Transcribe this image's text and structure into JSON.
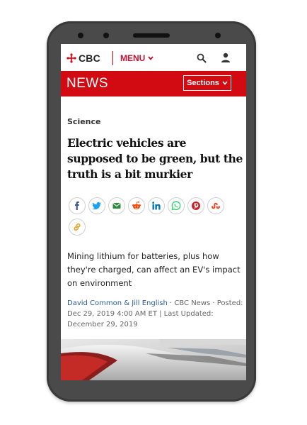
{
  "header": {
    "logo_text": "CBC",
    "menu_label": "MENU",
    "menu_chevron": "⌄"
  },
  "newsbar": {
    "title": "NEWS",
    "sections_label": "Sections",
    "sections_chevron": "⌄"
  },
  "article": {
    "category": "Science",
    "headline": "Electric vehicles are supposed to be green, but the truth is a bit murkier",
    "dek": "Mining lithium for batteries, plus how they're charged, can affect an EV's impact on environment",
    "authors": "David Common & Jill English",
    "source": " · CBC News · ",
    "posted": "Posted: Dec 29, 2019 4:00 AM ET | Last Updated: December 29, 2019"
  },
  "share_icons": [
    {
      "name": "facebook-icon",
      "color": "#3b5998"
    },
    {
      "name": "twitter-icon",
      "color": "#1da1f2"
    },
    {
      "name": "email-icon",
      "color": "#2e8b3e"
    },
    {
      "name": "reddit-icon",
      "color": "#ff4500"
    },
    {
      "name": "linkedin-icon",
      "color": "#0077b5"
    },
    {
      "name": "whatsapp-icon",
      "color": "#25d366"
    },
    {
      "name": "pinterest-icon",
      "color": "#cb2027"
    },
    {
      "name": "stumbleupon-icon",
      "color": "#eb4924"
    },
    {
      "name": "link-icon",
      "color": "#e8a52a"
    }
  ],
  "colors": {
    "brand_red": "#d20a11",
    "menu_red": "#c8102e",
    "phone_body": "#4a4a4a"
  }
}
